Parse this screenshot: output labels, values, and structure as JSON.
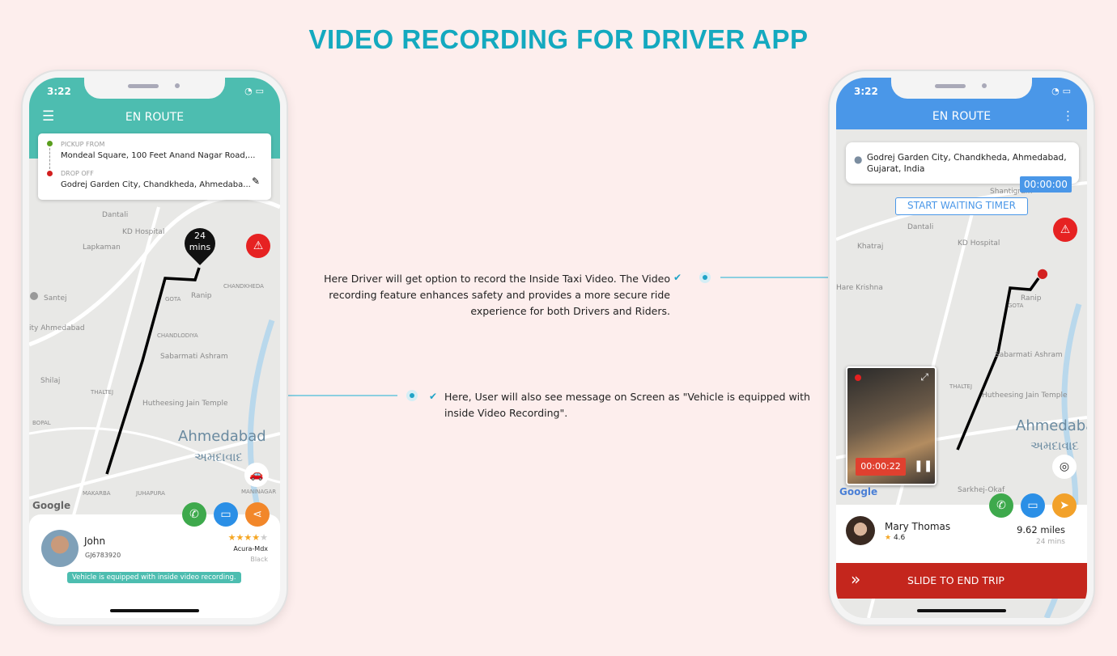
{
  "page_title": "VIDEO RECORDING FOR DRIVER APP",
  "callouts": [
    "Here Driver will get option to record the Inside Taxi Video. The Video recording feature enhances safety and provides a more secure ride experience for both Drivers and Riders.",
    "Here, User will also see message on Screen as \"Vehicle is equipped with inside Video Recording\"."
  ],
  "left_phone": {
    "time": "3:22",
    "header": "EN ROUTE",
    "header_color": "#4dbdb0",
    "pickup_label": "PICKUP FROM",
    "pickup": "Mondeal Square, 100 Feet Anand Nagar Road,...",
    "drop_label": "DROP OFF",
    "drop": "Godrej Garden City, Chandkheda, Ahmedaba...",
    "eta_value": "24",
    "eta_unit": "mins",
    "map_labels": [
      "KD Hospital",
      "Lapkaman",
      "Dantali",
      "Santej",
      "Ranip",
      "GOTA",
      "CHANDLODIYA",
      "Sabarmati Ashram",
      "Shilaj",
      "THALTEJ",
      "Hutheesing Jain Temple",
      "Ahmedabad",
      "અમદાવાદ",
      "BOPAL",
      "MAKARBA",
      "JUHAPURA",
      "CHANDKHEDA",
      "MANINAGAR",
      "ity Ahmedabad"
    ],
    "driver_name": "John",
    "driver_id": "GJ6783920",
    "rating": 4.5,
    "car_model": "Acura-Mdx",
    "car_color": "Black",
    "notice": "Vehicle is equipped with inside video recording."
  },
  "right_phone": {
    "time": "3:22",
    "header": "EN ROUTE",
    "header_color": "#4a97e8",
    "destination": "Godrej Garden City, Chandkheda, Ahmedabad, Gujarat, India",
    "wait_timer": "00:00:00",
    "wait_button": "START WAITING TIMER",
    "map_labels": [
      "Shantigram",
      "Dantali",
      "KD Hospital",
      "Khatraj",
      "Hare Krishna",
      "Ranip",
      "GOTA",
      "Sabarmati Ashram",
      "THALTEJ",
      "Hutheesing Jain Temple",
      "Ahmedabad",
      "અમદાવાદ",
      "Sarkhej-Okaf"
    ],
    "recording_time": "00:00:22",
    "rider_name": "Mary Thomas",
    "rider_rating": "4.6",
    "distance": "9.62 miles",
    "duration": "24 mins",
    "slide_label": "SLIDE TO END TRIP"
  }
}
